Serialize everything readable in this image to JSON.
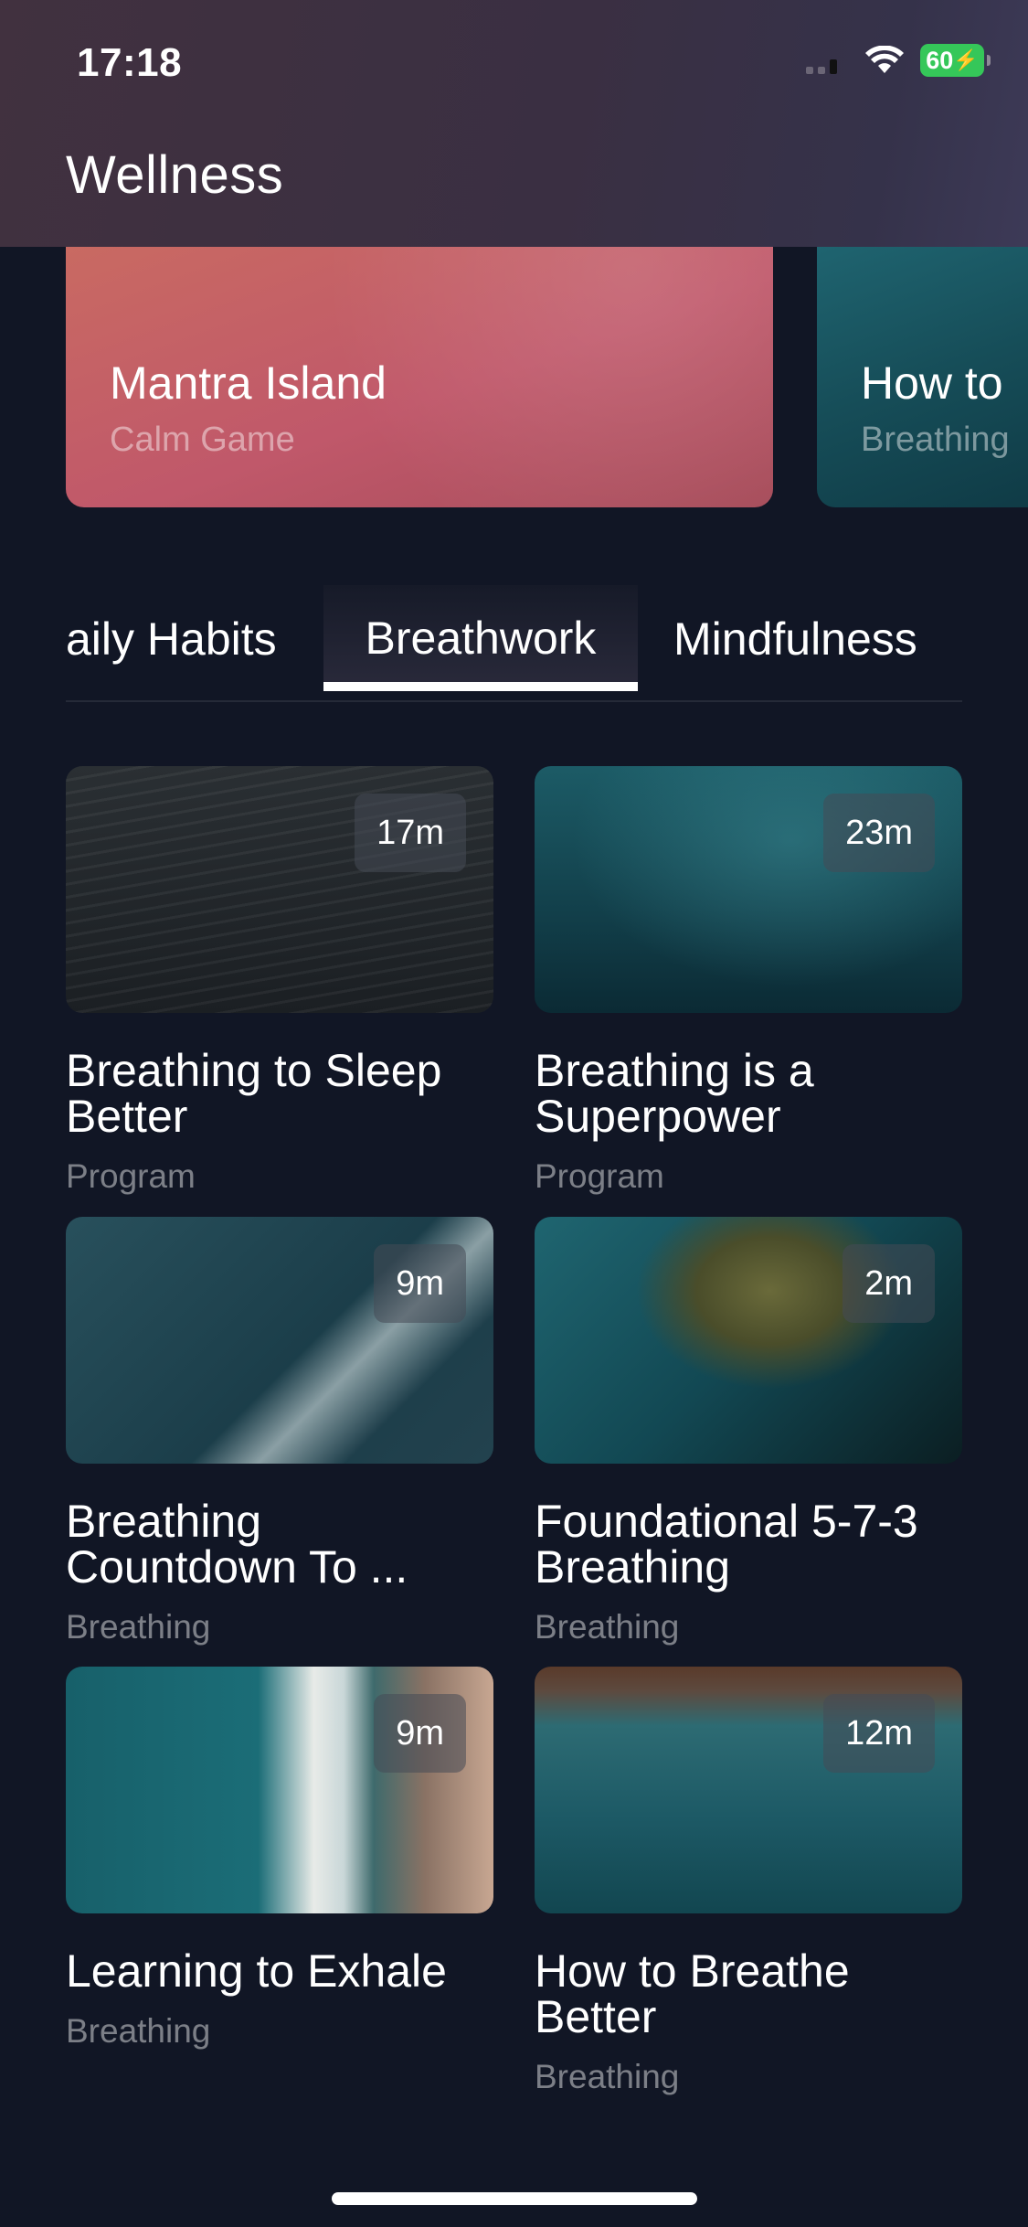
{
  "status_bar": {
    "time": "17:18",
    "battery": "60"
  },
  "header": {
    "title": "Wellness"
  },
  "featured": [
    {
      "title": "Mantra Island",
      "subtitle": "Calm Game"
    },
    {
      "title": "How to",
      "subtitle": "Breathing"
    }
  ],
  "tabs": [
    {
      "label": "aily Habits",
      "active": false
    },
    {
      "label": "Breathwork",
      "active": true
    },
    {
      "label": "Mindfulness",
      "active": false
    }
  ],
  "items": [
    {
      "title": "Breathing to Sleep Better",
      "type": "Program",
      "duration": "17m"
    },
    {
      "title": "Breathing is a Superpower",
      "type": "Program",
      "duration": "23m"
    },
    {
      "title": "Breathing Countdown To ...",
      "type": "Breathing",
      "duration": "9m"
    },
    {
      "title": "Foundational 5-7-3 Breathing",
      "type": "Breathing",
      "duration": "2m"
    },
    {
      "title": "Learning to Exhale",
      "type": "Breathing",
      "duration": "9m"
    },
    {
      "title": "How to Breathe Better",
      "type": "Breathing",
      "duration": "12m"
    }
  ],
  "colors": {
    "background": "#111625",
    "accent_underline": "#ffffff",
    "battery": "#35c759"
  }
}
